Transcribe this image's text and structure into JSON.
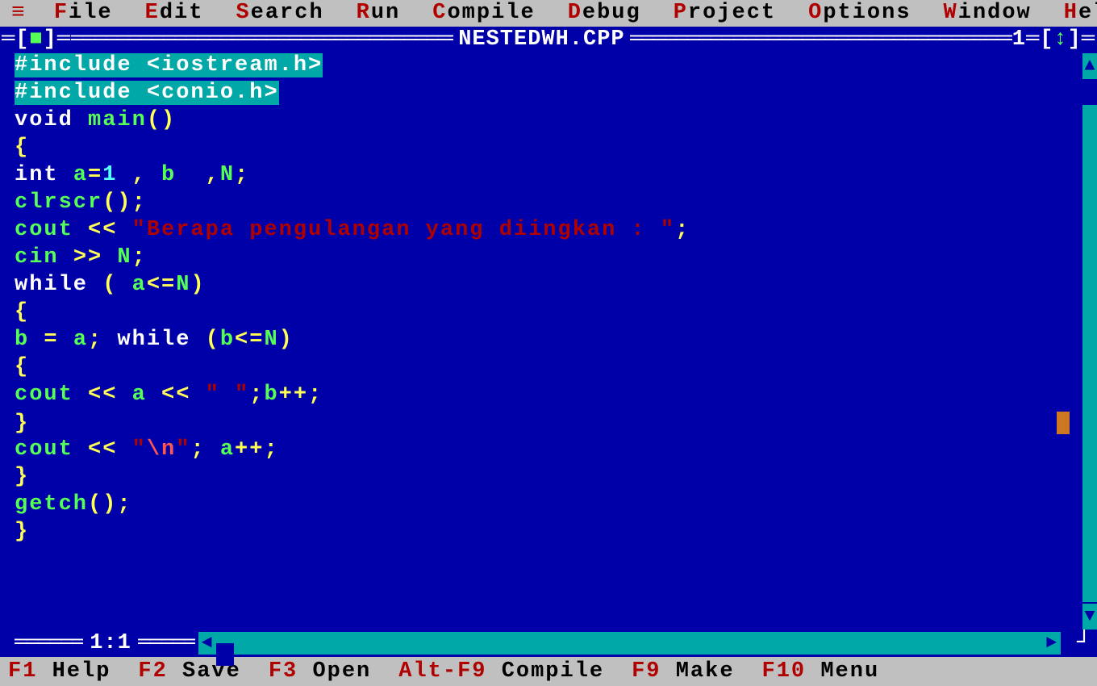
{
  "menu": {
    "icon": "≡",
    "items": [
      "File",
      "Edit",
      "Search",
      "Run",
      "Compile",
      "Debug",
      "Project",
      "Options",
      "Window",
      "Help"
    ]
  },
  "titlebar": {
    "left_bracket_l": "═[",
    "close": "■",
    "left_bracket_r": "]═",
    "filename": "NESTEDWH.CPP",
    "window_number": "1",
    "right_seg": "═[",
    "arrow": "↕",
    "right_end": "]═"
  },
  "code": [
    [
      {
        "t": "#include <iostream.h>",
        "cls": "sel"
      }
    ],
    [
      {
        "t": "#include <conio.h>",
        "cls": "sel"
      }
    ],
    [
      {
        "t": "void ",
        "cls": "c-white"
      },
      {
        "t": "main",
        "cls": "c-green"
      },
      {
        "t": "()",
        "cls": "c-yellow"
      }
    ],
    [
      {
        "t": "{",
        "cls": "c-yellow"
      }
    ],
    [
      {
        "t": "int ",
        "cls": "c-white"
      },
      {
        "t": "a",
        "cls": "c-green"
      },
      {
        "t": "=",
        "cls": "c-yellow"
      },
      {
        "t": "1",
        "cls": "c-cyan"
      },
      {
        "t": " , ",
        "cls": "c-yellow"
      },
      {
        "t": "b ",
        "cls": "c-green"
      },
      {
        "t": " ,",
        "cls": "c-yellow"
      },
      {
        "t": "N",
        "cls": "c-green"
      },
      {
        "t": ";",
        "cls": "c-yellow"
      }
    ],
    [
      {
        "t": "clrscr",
        "cls": "c-green"
      },
      {
        "t": "();",
        "cls": "c-yellow"
      }
    ],
    [
      {
        "t": "cout ",
        "cls": "c-green"
      },
      {
        "t": "<< ",
        "cls": "c-yellow"
      },
      {
        "t": "\"Berapa pengulangan yang diingkan : \"",
        "cls": "c-red"
      },
      {
        "t": ";",
        "cls": "c-yellow"
      }
    ],
    [
      {
        "t": "cin ",
        "cls": "c-green"
      },
      {
        "t": ">> ",
        "cls": "c-yellow"
      },
      {
        "t": "N",
        "cls": "c-green"
      },
      {
        "t": ";",
        "cls": "c-yellow"
      }
    ],
    [
      {
        "t": "while ",
        "cls": "c-white"
      },
      {
        "t": "( ",
        "cls": "c-yellow"
      },
      {
        "t": "a",
        "cls": "c-green"
      },
      {
        "t": "<=",
        "cls": "c-yellow"
      },
      {
        "t": "N",
        "cls": "c-green"
      },
      {
        "t": ")",
        "cls": "c-yellow"
      }
    ],
    [
      {
        "t": "{",
        "cls": "c-yellow"
      }
    ],
    [
      {
        "t": "b ",
        "cls": "c-green"
      },
      {
        "t": "= ",
        "cls": "c-yellow"
      },
      {
        "t": "a",
        "cls": "c-green"
      },
      {
        "t": "; ",
        "cls": "c-yellow"
      },
      {
        "t": "while ",
        "cls": "c-white"
      },
      {
        "t": "(",
        "cls": "c-yellow"
      },
      {
        "t": "b",
        "cls": "c-green"
      },
      {
        "t": "<=",
        "cls": "c-yellow"
      },
      {
        "t": "N",
        "cls": "c-green"
      },
      {
        "t": ")",
        "cls": "c-yellow"
      }
    ],
    [
      {
        "t": "{",
        "cls": "c-yellow"
      }
    ],
    [
      {
        "t": "cout ",
        "cls": "c-green"
      },
      {
        "t": "<< ",
        "cls": "c-yellow"
      },
      {
        "t": "a ",
        "cls": "c-green"
      },
      {
        "t": "<< ",
        "cls": "c-yellow"
      },
      {
        "t": "\" \"",
        "cls": "c-red"
      },
      {
        "t": ";",
        "cls": "c-yellow"
      },
      {
        "t": "b",
        "cls": "c-green"
      },
      {
        "t": "++;",
        "cls": "c-yellow"
      }
    ],
    [
      {
        "t": "}",
        "cls": "c-yellow"
      },
      {
        "caret": true
      }
    ],
    [
      {
        "t": "cout ",
        "cls": "c-green"
      },
      {
        "t": "<< ",
        "cls": "c-yellow"
      },
      {
        "t": "\"",
        "cls": "c-red"
      },
      {
        "t": "\\n",
        "cls": "c-redbr"
      },
      {
        "t": "\"",
        "cls": "c-red"
      },
      {
        "t": "; ",
        "cls": "c-yellow"
      },
      {
        "t": "a",
        "cls": "c-green"
      },
      {
        "t": "++;",
        "cls": "c-yellow"
      }
    ],
    [
      {
        "t": "}",
        "cls": "c-yellow"
      }
    ],
    [
      {
        "t": "getch",
        "cls": "c-green"
      },
      {
        "t": "();",
        "cls": "c-yellow"
      }
    ],
    [
      {
        "t": "}",
        "cls": "c-yellow"
      }
    ]
  ],
  "position": "1:1",
  "status": [
    {
      "key": "F1",
      "label": "Help"
    },
    {
      "key": "F2",
      "label": "Save"
    },
    {
      "key": "F3",
      "label": "Open"
    },
    {
      "key": "Alt-F9",
      "label": "Compile"
    },
    {
      "key": "F9",
      "label": "Make"
    },
    {
      "key": "F10",
      "label": "Menu"
    }
  ]
}
